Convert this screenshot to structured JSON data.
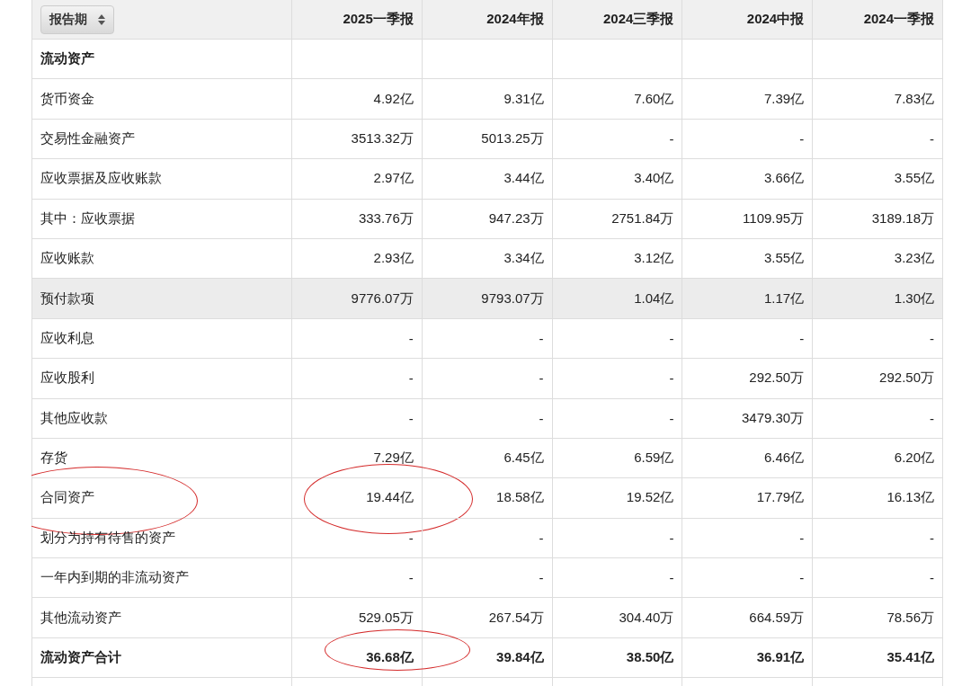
{
  "table": {
    "period_button": {
      "label": "报告期"
    },
    "columns": [
      "2025一季报",
      "2024年报",
      "2024三季报",
      "2024中报",
      "2024一季报"
    ],
    "rows": [
      {
        "label": "流动资产",
        "values": [],
        "bold": true,
        "highlighted": false,
        "circled": [
          false,
          false,
          false,
          false,
          false,
          false
        ]
      },
      {
        "label": "货币资金",
        "values": [
          "4.92亿",
          "9.31亿",
          "7.60亿",
          "7.39亿",
          "7.83亿"
        ],
        "bold": false,
        "highlighted": false,
        "circled": [
          false,
          false,
          false,
          false,
          false,
          false
        ]
      },
      {
        "label": "交易性金融资产",
        "values": [
          "3513.32万",
          "5013.25万",
          "-",
          "-",
          "-"
        ],
        "bold": false,
        "highlighted": false,
        "circled": [
          false,
          false,
          false,
          false,
          false,
          false
        ]
      },
      {
        "label": "应收票据及应收账款",
        "values": [
          "2.97亿",
          "3.44亿",
          "3.40亿",
          "3.66亿",
          "3.55亿"
        ],
        "bold": false,
        "highlighted": false,
        "circled": [
          false,
          false,
          false,
          false,
          false,
          false
        ]
      },
      {
        "label": "其中：应收票据",
        "values": [
          "333.76万",
          "947.23万",
          "2751.84万",
          "1109.95万",
          "3189.18万"
        ],
        "bold": false,
        "highlighted": false,
        "circled": [
          false,
          false,
          false,
          false,
          false,
          false
        ]
      },
      {
        "label": "应收账款",
        "values": [
          "2.93亿",
          "3.34亿",
          "3.12亿",
          "3.55亿",
          "3.23亿"
        ],
        "bold": false,
        "highlighted": false,
        "circled": [
          false,
          false,
          false,
          false,
          false,
          false
        ]
      },
      {
        "label": "预付款项",
        "values": [
          "9776.07万",
          "9793.07万",
          "1.04亿",
          "1.17亿",
          "1.30亿"
        ],
        "bold": false,
        "highlighted": true,
        "circled": [
          false,
          false,
          false,
          false,
          false,
          false
        ]
      },
      {
        "label": "应收利息",
        "values": [
          "-",
          "-",
          "-",
          "-",
          "-"
        ],
        "bold": false,
        "highlighted": false,
        "circled": [
          false,
          false,
          false,
          false,
          false,
          false
        ]
      },
      {
        "label": "应收股利",
        "values": [
          "-",
          "-",
          "-",
          "292.50万",
          "292.50万"
        ],
        "bold": false,
        "highlighted": false,
        "circled": [
          false,
          false,
          false,
          false,
          false,
          false
        ]
      },
      {
        "label": "其他应收款",
        "values": [
          "-",
          "-",
          "-",
          "3479.30万",
          "-"
        ],
        "bold": false,
        "highlighted": false,
        "circled": [
          false,
          false,
          false,
          false,
          false,
          false
        ]
      },
      {
        "label": "存货",
        "values": [
          "7.29亿",
          "6.45亿",
          "6.59亿",
          "6.46亿",
          "6.20亿"
        ],
        "bold": false,
        "highlighted": false,
        "circled": [
          false,
          false,
          false,
          false,
          false,
          false
        ]
      },
      {
        "label": "合同资产",
        "values": [
          "19.44亿",
          "18.58亿",
          "19.52亿",
          "17.79亿",
          "16.13亿"
        ],
        "bold": false,
        "highlighted": false,
        "circled": [
          true,
          true,
          false,
          false,
          false,
          false
        ]
      },
      {
        "label": "划分为持有待售的资产",
        "values": [
          "-",
          "-",
          "-",
          "-",
          "-"
        ],
        "bold": false,
        "highlighted": false,
        "circled": [
          false,
          false,
          false,
          false,
          false,
          false
        ]
      },
      {
        "label": "一年内到期的非流动资产",
        "values": [
          "-",
          "-",
          "-",
          "-",
          "-"
        ],
        "bold": false,
        "highlighted": false,
        "circled": [
          false,
          false,
          false,
          false,
          false,
          false
        ]
      },
      {
        "label": "其他流动资产",
        "values": [
          "529.05万",
          "267.54万",
          "304.40万",
          "664.59万",
          "78.56万"
        ],
        "bold": false,
        "highlighted": false,
        "circled": [
          false,
          false,
          false,
          false,
          false,
          false
        ]
      },
      {
        "label": "流动资产合计",
        "values": [
          "36.68亿",
          "39.84亿",
          "38.50亿",
          "36.91亿",
          "35.41亿"
        ],
        "bold": true,
        "highlighted": false,
        "circled": [
          false,
          true,
          false,
          false,
          false,
          false
        ]
      }
    ]
  }
}
